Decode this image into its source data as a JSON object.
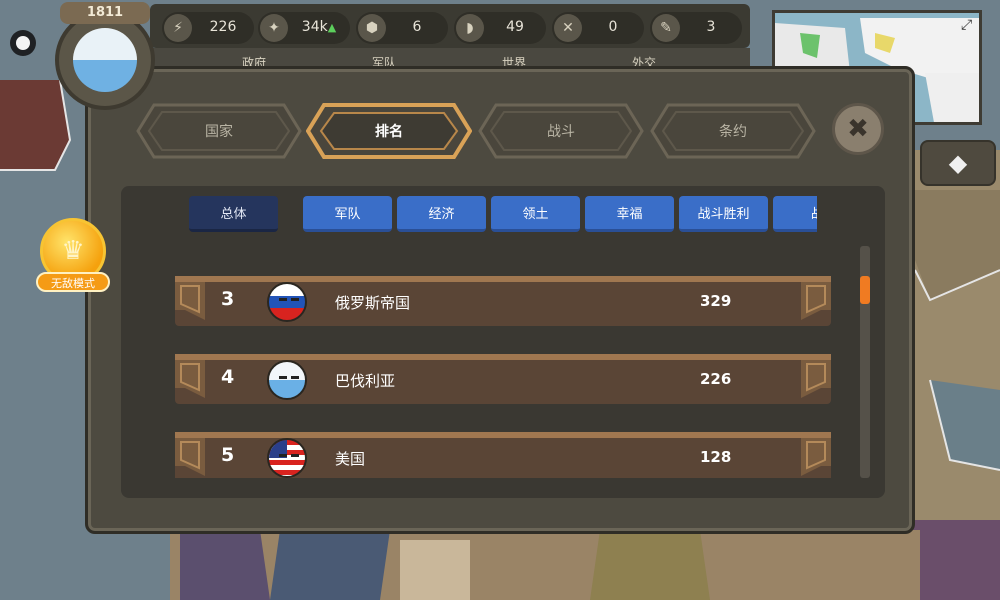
{
  "hud": {
    "year": "1811",
    "resources": [
      {
        "icon": "lightning-icon",
        "glyph": "⚡",
        "value": "226",
        "up": false
      },
      {
        "icon": "gold-icon",
        "glyph": "✦",
        "value": "34k",
        "up": true,
        "up_glyph": "▲"
      },
      {
        "icon": "industry-icon",
        "glyph": "⬢",
        "value": "6",
        "up": false
      },
      {
        "icon": "manpower-icon",
        "glyph": "◗",
        "value": "49",
        "up": false
      },
      {
        "icon": "swords-icon",
        "glyph": "✕",
        "value": "0",
        "up": false
      },
      {
        "icon": "pen-icon",
        "glyph": "✎",
        "value": "3",
        "up": false
      }
    ],
    "subtabs": [
      "政府",
      "军队",
      "世界",
      "外交"
    ]
  },
  "side": {
    "invincible_label": "无敌模式",
    "invincible_glyph": "♛",
    "diamond_glyph": "◆"
  },
  "panel": {
    "tabs": [
      {
        "label": "国家",
        "active": false
      },
      {
        "label": "排名",
        "active": true
      },
      {
        "label": "战斗",
        "active": false
      },
      {
        "label": "条约",
        "active": false
      }
    ],
    "close_glyph": "✖",
    "categories": [
      {
        "label": "总体",
        "active": true
      },
      {
        "label": "军队",
        "active": false
      },
      {
        "label": "经济",
        "active": false
      },
      {
        "label": "领土",
        "active": false
      },
      {
        "label": "幸福",
        "active": false
      },
      {
        "label": "战斗胜利",
        "active": false
      },
      {
        "label": "战",
        "active": false
      }
    ],
    "rankings": [
      {
        "rank": "3",
        "name": "俄罗斯帝国",
        "score": "329",
        "flag": "russia"
      },
      {
        "rank": "4",
        "name": "巴伐利亚",
        "score": "226",
        "flag": "bavaria"
      },
      {
        "rank": "5",
        "name": "美国",
        "score": "128",
        "flag": "usa"
      }
    ]
  },
  "colors": {
    "accent_orange": "#f07b22",
    "category_blue": "#3a6ec8",
    "category_active": "#25355d",
    "tab_gold": "#d9a257"
  }
}
